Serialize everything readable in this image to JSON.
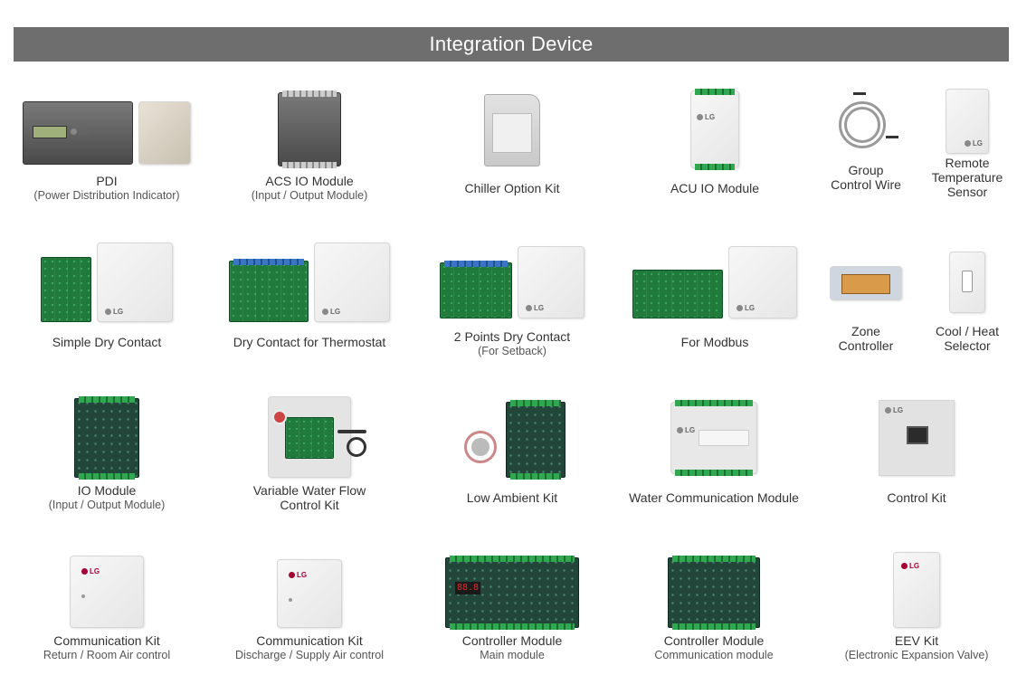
{
  "header": {
    "title": "Integration Device"
  },
  "items": [
    {
      "name": "PDI",
      "sub": "(Power Distribution Indicator)"
    },
    {
      "name": "ACS IO Module",
      "sub": "(Input / Output Module)"
    },
    {
      "name": "Chiller Option Kit",
      "sub": ""
    },
    {
      "name": "ACU IO Module",
      "sub": ""
    },
    {
      "name": "Group\nControl Wire",
      "sub": ""
    },
    {
      "name": "Remote\nTemperature\nSensor",
      "sub": ""
    },
    {
      "name": "Simple Dry Contact",
      "sub": ""
    },
    {
      "name": "Dry Contact for Thermostat",
      "sub": ""
    },
    {
      "name": "2 Points Dry Contact",
      "sub": "(For Setback)"
    },
    {
      "name": "For Modbus",
      "sub": ""
    },
    {
      "name": "Zone\nController",
      "sub": ""
    },
    {
      "name": "Cool / Heat\nSelector",
      "sub": ""
    },
    {
      "name": "IO Module",
      "sub": "(Input / Output Module)"
    },
    {
      "name": "Variable Water Flow\nControl Kit",
      "sub": ""
    },
    {
      "name": "Low Ambient Kit",
      "sub": ""
    },
    {
      "name": "Water Communication Module",
      "sub": ""
    },
    {
      "name": "Control Kit",
      "sub": ""
    },
    {
      "name": "Communication Kit",
      "sub": "Return / Room Air control"
    },
    {
      "name": "Communication Kit",
      "sub": "Discharge / Supply Air control"
    },
    {
      "name": "Controller Module",
      "sub": "Main module"
    },
    {
      "name": "Controller Module",
      "sub": "Communication module"
    },
    {
      "name": "EEV Kit",
      "sub": "(Electronic Expansion Valve)"
    }
  ],
  "logo_text": "LG",
  "digit_text": "88.8",
  "colors": {
    "header_bg": "#6e6e6e",
    "header_text": "#ffffff",
    "lg_red": "#a50034"
  }
}
